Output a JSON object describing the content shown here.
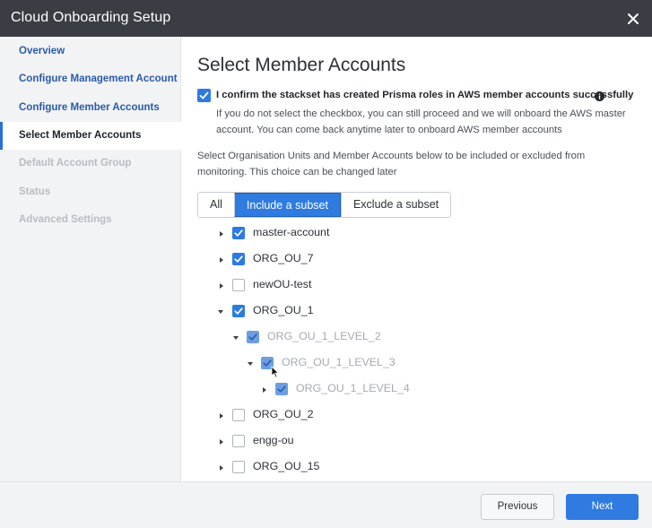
{
  "header": {
    "title": "Cloud Onboarding Setup",
    "close_icon": "close-icon"
  },
  "sidebar": {
    "items": [
      {
        "label": "Overview",
        "state": "link"
      },
      {
        "label": "Configure Management Account",
        "state": "link"
      },
      {
        "label": "Configure Member Accounts",
        "state": "link"
      },
      {
        "label": "Select Member Accounts",
        "state": "active"
      },
      {
        "label": "Default Account Group",
        "state": "disabled"
      },
      {
        "label": "Status",
        "state": "disabled"
      },
      {
        "label": "Advanced Settings",
        "state": "disabled"
      }
    ]
  },
  "main": {
    "title": "Select Member Accounts",
    "confirm": {
      "checked": true,
      "label": "I confirm the stackset has created Prisma roles in AWS member accounts successfully",
      "info_icon": "info-icon",
      "help": "If you do not select the checkbox, you can still proceed and we will onboard the AWS master account. You can come back anytime later to onboard AWS member accounts"
    },
    "select_help": "Select Organisation Units and Member Accounts below to be included or excluded from monitoring. This choice can be changed later",
    "scope_options": [
      {
        "label": "All",
        "selected": false
      },
      {
        "label": "Include a subset",
        "selected": true
      },
      {
        "label": "Exclude a subset",
        "selected": false
      }
    ],
    "tree": [
      {
        "label": "master-account",
        "checked": true,
        "expanded": false,
        "dimmed": false
      },
      {
        "label": "ORG_OU_7",
        "checked": true,
        "expanded": false,
        "dimmed": false
      },
      {
        "label": "newOU-test",
        "checked": false,
        "expanded": false,
        "dimmed": false
      },
      {
        "label": "ORG_OU_1",
        "checked": true,
        "expanded": true,
        "dimmed": false
      },
      {
        "label": "ORG_OU_1_LEVEL_2",
        "checked": true,
        "expanded": true,
        "dimmed": true
      },
      {
        "label": "ORG_OU_1_LEVEL_3",
        "checked": true,
        "expanded": true,
        "dimmed": true
      },
      {
        "label": "ORG_OU_1_LEVEL_4",
        "checked": true,
        "expanded": false,
        "dimmed": true
      },
      {
        "label": "ORG_OU_2",
        "checked": false,
        "expanded": false,
        "dimmed": false
      },
      {
        "label": "engg-ou",
        "checked": false,
        "expanded": false,
        "dimmed": false
      },
      {
        "label": "ORG_OU_15",
        "checked": false,
        "expanded": false,
        "dimmed": false
      }
    ]
  },
  "footer": {
    "previous_label": "Previous",
    "next_label": "Next"
  },
  "colors": {
    "header_bg": "#3a3d43",
    "accent": "#2f7be0",
    "sidebar_bg": "#f2f3f5",
    "link": "#2a5ba8",
    "disabled": "#b8bcc3"
  }
}
